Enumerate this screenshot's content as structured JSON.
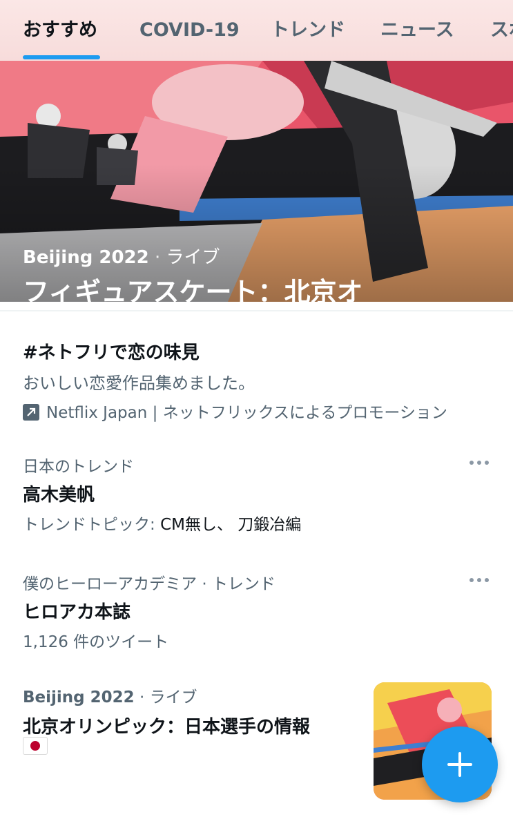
{
  "tabs": [
    {
      "label": "おすすめ",
      "active": true
    },
    {
      "label": "COVID-19",
      "active": false
    },
    {
      "label": "トレンド",
      "active": false
    },
    {
      "label": "ニュース",
      "active": false
    },
    {
      "label": "スポ",
      "active": false
    }
  ],
  "hero": {
    "source": "Beijing 2022",
    "separator": "·",
    "status": "ライブ",
    "title": "フィギュアスケート：北京オリンピック"
  },
  "promoted": {
    "title": "#ネトフリで恋の味見",
    "description": "おいしい恋愛作品集めました。",
    "promoter_line": "Netflix Japan | ネットフリックスによるプロモーション",
    "icon": "promoted-arrow-icon"
  },
  "trends": [
    {
      "context": "日本のトレンド",
      "title": "高木美帆",
      "topics_prefix": "トレンドトピック:",
      "topics": "CM無し、 刀鍛冶編",
      "more_icon": "more-dots-icon"
    },
    {
      "context": "僕のヒーローアカデミア · トレンド",
      "title": "ヒロアカ本誌",
      "tweet_count": "1,126 件のツイート",
      "more_icon": "more-dots-icon"
    }
  ],
  "live_event": {
    "source": "Beijing 2022",
    "separator": "·",
    "status": "ライブ",
    "title": "北京オリンピック：日本選手の情報",
    "flag_icon": "japan-flag-icon"
  },
  "fab": {
    "icon": "plus-icon"
  },
  "colors": {
    "accent": "#1d9bf0",
    "text_primary": "#0f1419",
    "text_secondary": "#536471",
    "divider": "#eff3f4"
  }
}
